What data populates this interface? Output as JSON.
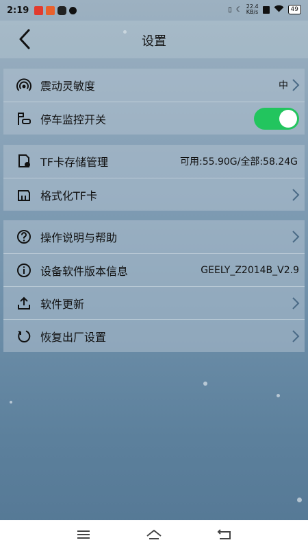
{
  "status_bar": {
    "time": "2:19",
    "network_speed": "22.4",
    "network_unit": "KB/s",
    "battery": "49"
  },
  "header": {
    "title": "设置"
  },
  "groups": [
    {
      "items": [
        {
          "label": "震动灵敏度",
          "value": "中",
          "icon": "vibration-icon",
          "chevron": true
        },
        {
          "label": "停车监控开关",
          "icon": "parking-monitor-icon",
          "toggle_on": true
        }
      ]
    },
    {
      "items": [
        {
          "label": "TF卡存储管理",
          "value": "可用:55.90G/全部:58.24G",
          "icon": "sd-card-storage-icon"
        },
        {
          "label": "格式化TF卡",
          "icon": "sd-card-icon",
          "chevron": true
        }
      ]
    },
    {
      "items": [
        {
          "label": "操作说明与帮助",
          "icon": "help-icon",
          "chevron": true
        },
        {
          "label": "设备软件版本信息",
          "value": "GEELY_Z2014B_V2.9",
          "icon": "info-icon"
        },
        {
          "label": "软件更新",
          "icon": "upload-icon",
          "chevron": true
        },
        {
          "label": "恢复出厂设置",
          "icon": "reset-icon",
          "chevron": true
        }
      ]
    }
  ],
  "colors": {
    "toggle_on": "#22c55e",
    "accent_red": "#e23b2e"
  }
}
